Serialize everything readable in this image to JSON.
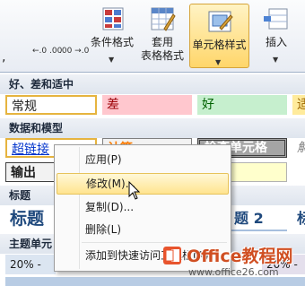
{
  "ribbon": {
    "left_fragments": [
      ",",
      "←.0 .00",
      ".00 →.0"
    ],
    "conditional_format": "条件格式",
    "table_format_line1": "套用",
    "table_format_line2": "表格格式",
    "cell_styles": "单元格样式",
    "insert": "插入"
  },
  "gallery": {
    "section_good_bad": "好、差和适中",
    "normal": "常规",
    "bad": "差",
    "good": "好",
    "neutral_partial": "适",
    "section_data_model": "数据和模型",
    "hyperlink": "超链接",
    "calc_partial": "计算",
    "check_cell": "检查单元格",
    "explanatory_partial": "解",
    "output": "输出",
    "section_title": "标题",
    "title": "标题",
    "heading_partial": "题 2",
    "heading_right_partial": "标",
    "section_theme": "主题单元",
    "pct_20": "20% - ",
    "pct_20_b": "20% -"
  },
  "context_menu": {
    "items": [
      "应用(P)",
      "修改(M)...",
      "复制(D)...",
      "删除(L)",
      "添加到快速访问工具栏(A)"
    ]
  },
  "watermark": {
    "brand": "Office教程网",
    "url": "www.office26.com"
  }
}
